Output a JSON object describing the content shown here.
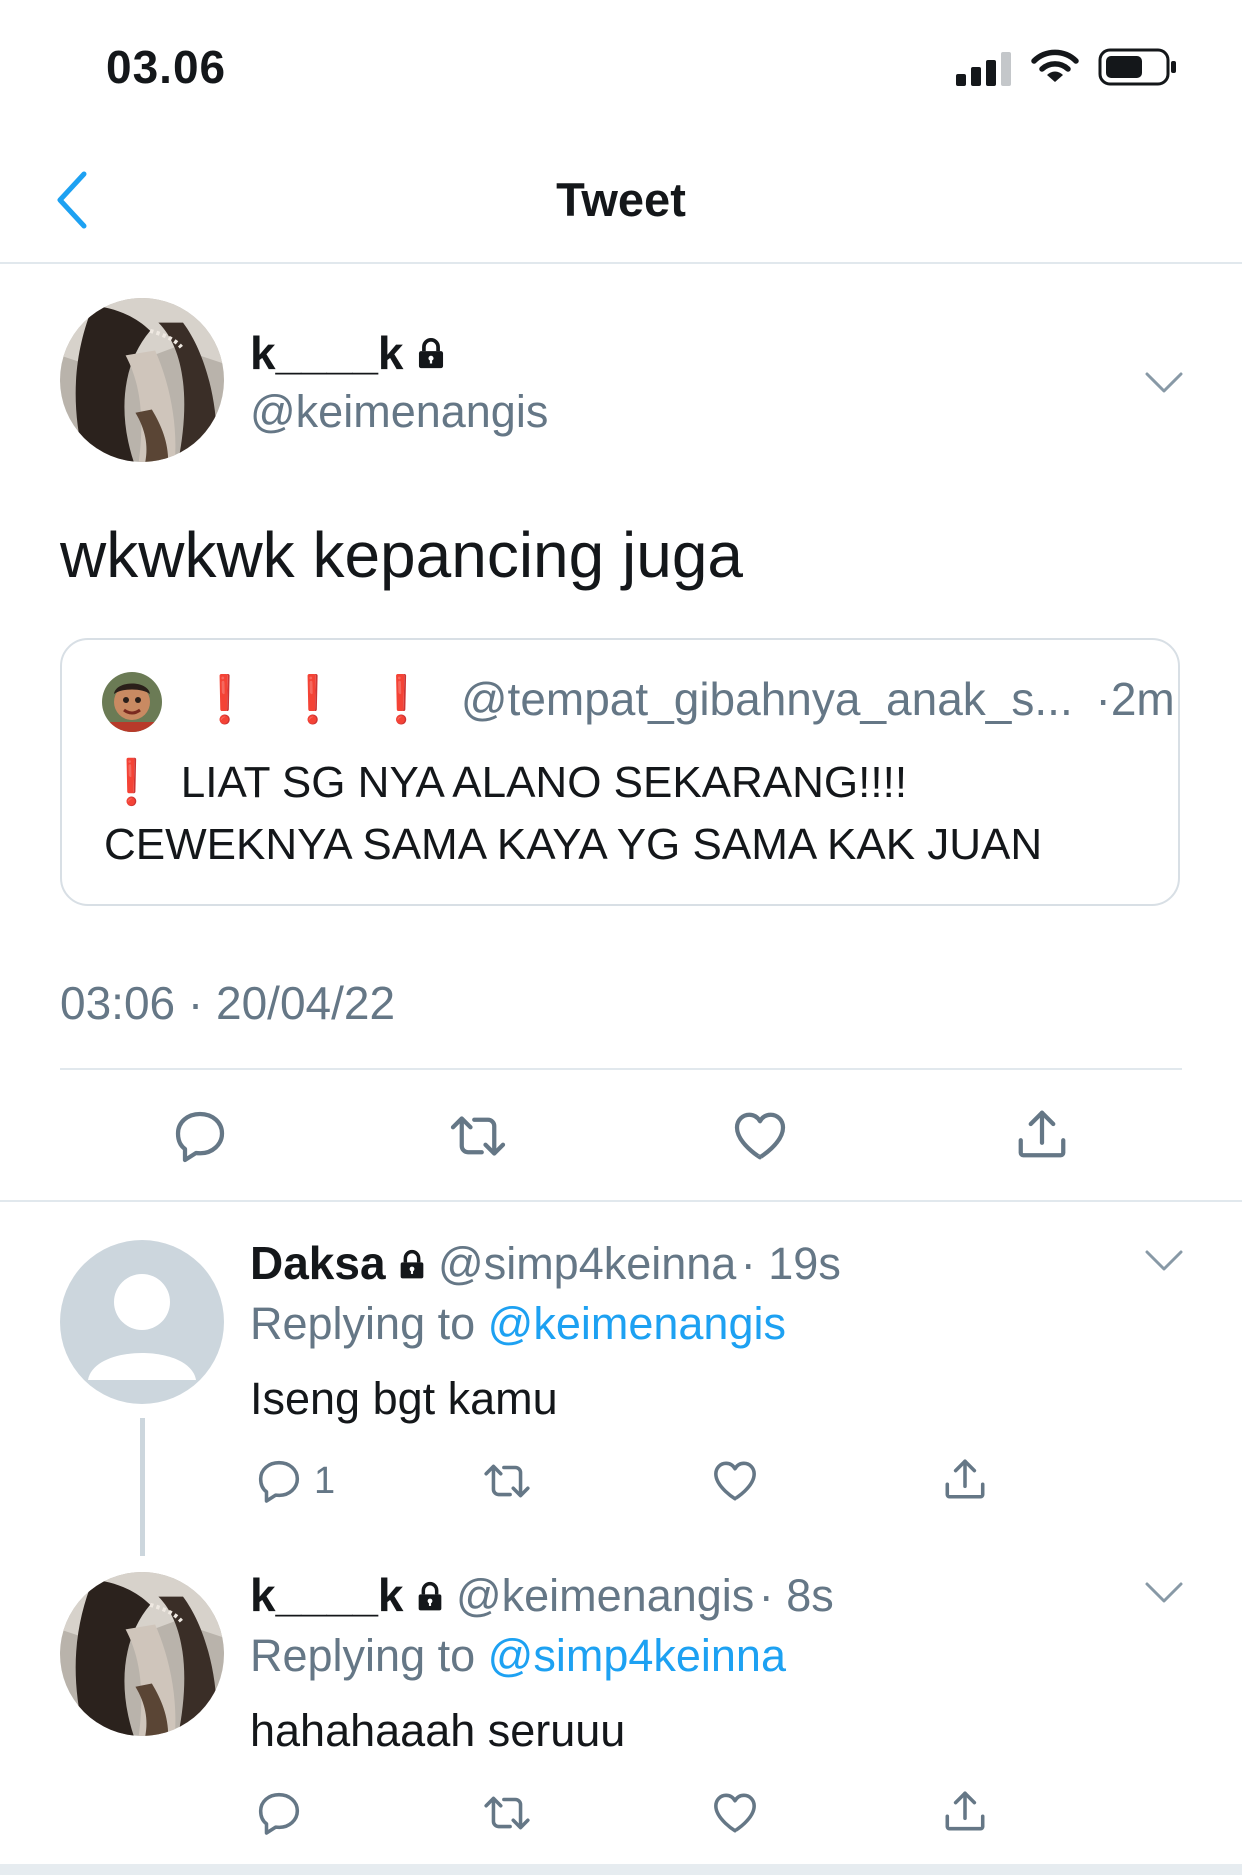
{
  "status_bar": {
    "time": "03.06"
  },
  "nav": {
    "title": "Tweet"
  },
  "main_tweet": {
    "name": "k____k",
    "handle": "@keimenangis",
    "text": "wkwkwk kepancing juga",
    "quote": {
      "name_marks": "❗❗❗",
      "handle": "@tempat_gibahnya_anak_s...",
      "time": "·2m",
      "line1": "LIAT SG NYA ALANO SEKARANG!!!!",
      "line2": "CEWEKNYA SAMA KAYA YG SAMA KAK JUAN"
    },
    "timestamp": "03:06 · 20/04/22"
  },
  "replies": [
    {
      "name": "Daksa",
      "handle": "@simp4keinna",
      "time": "· 19s",
      "replying_label": "Replying to",
      "replying_to": "@keimenangis",
      "text": "Iseng bgt kamu",
      "reply_count": "1"
    },
    {
      "name": "k____k",
      "handle": "@keimenangis",
      "time": "· 8s",
      "replying_label": "Replying to",
      "replying_to": "@simp4keinna",
      "text": "hahahaaah seruuu"
    }
  ],
  "colors": {
    "accent": "#1da1f2",
    "text": "#14171a",
    "muted": "#657786",
    "alert": "#e0243c"
  },
  "icons": [
    "signal-icon",
    "wifi-icon",
    "battery-icon",
    "back-chevron-icon",
    "lock-icon",
    "chevron-down-icon",
    "reply-icon",
    "retweet-icon",
    "like-icon",
    "share-icon",
    "default-avatar-icon"
  ]
}
